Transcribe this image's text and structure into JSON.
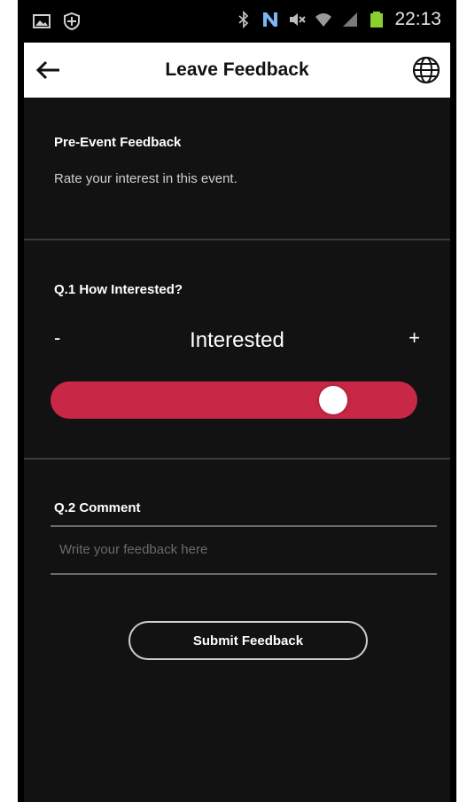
{
  "status_bar": {
    "time": "22:13",
    "left_icons": [
      "image-icon",
      "shield-icon"
    ],
    "right_icons": [
      "bluetooth-icon",
      "nfc-icon",
      "mute-icon",
      "wifi-icon",
      "signal-icon",
      "battery-icon"
    ]
  },
  "app_bar": {
    "title": "Leave Feedback",
    "back_icon": "back-arrow-icon",
    "globe_icon": "globe-icon"
  },
  "intro": {
    "title": "Pre-Event Feedback",
    "subtitle": "Rate your interest in this event."
  },
  "question1": {
    "label": "Q.1 How Interested?",
    "minus": "-",
    "plus": "+",
    "value": "Interested",
    "level_fraction": 0.8,
    "track_color": "#c82745"
  },
  "question2": {
    "label": "Q.2 Comment",
    "placeholder": "Write your feedback here"
  },
  "submit": {
    "label": "Submit Feedback"
  }
}
